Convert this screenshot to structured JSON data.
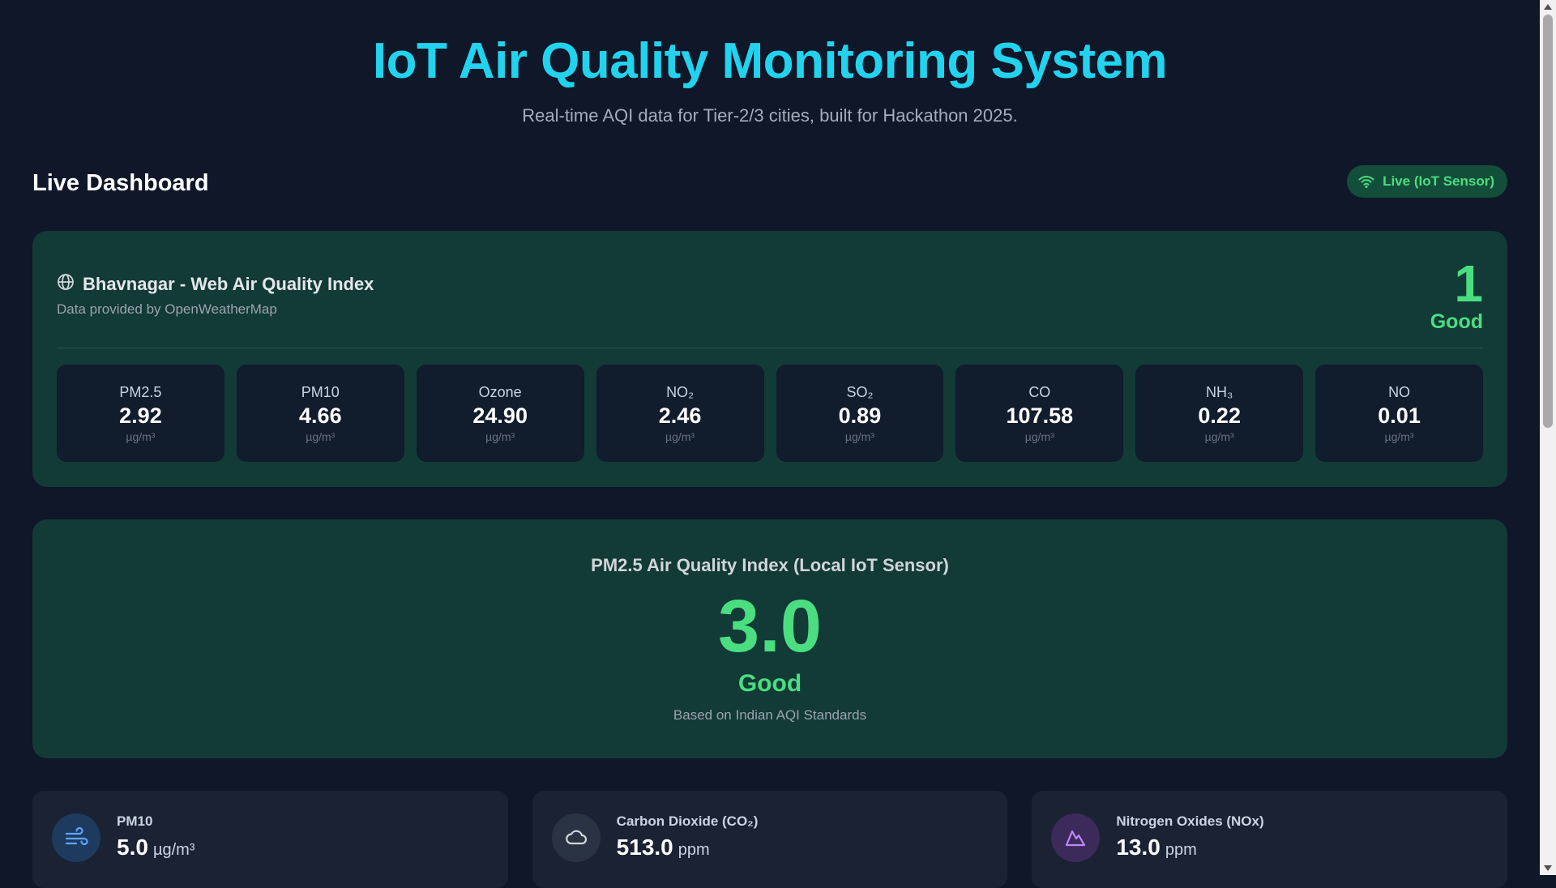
{
  "header": {
    "title": "IoT Air Quality Monitoring System",
    "subtitle": "Real-time AQI data for Tier-2/3 cities, built for Hackathon 2025."
  },
  "dashboard": {
    "title": "Live Dashboard",
    "status": {
      "label": "Live (IoT Sensor)",
      "icon": "wifi-icon",
      "color": "#4ade80"
    }
  },
  "web_aqi": {
    "icon": "globe-icon",
    "title": "Bhavnagar - Web Air Quality Index",
    "source": "Data provided by OpenWeatherMap",
    "aqi_value": "1",
    "aqi_label": "Good",
    "pollutants": [
      {
        "name": "PM2.5",
        "value": "2.92",
        "unit": "µg/m³"
      },
      {
        "name": "PM10",
        "value": "4.66",
        "unit": "µg/m³"
      },
      {
        "name": "Ozone",
        "value": "24.90",
        "unit": "µg/m³"
      },
      {
        "name": "NO₂",
        "value": "2.46",
        "unit": "µg/m³"
      },
      {
        "name": "SO₂",
        "value": "0.89",
        "unit": "µg/m³"
      },
      {
        "name": "CO",
        "value": "107.58",
        "unit": "µg/m³"
      },
      {
        "name": "NH₃",
        "value": "0.22",
        "unit": "µg/m³"
      },
      {
        "name": "NO",
        "value": "0.01",
        "unit": "µg/m³"
      }
    ]
  },
  "local_aqi": {
    "title": "PM2.5 Air Quality Index (Local IoT Sensor)",
    "value": "3.0",
    "label": "Good",
    "note": "Based on Indian AQI Standards"
  },
  "metrics": [
    {
      "label": "PM10",
      "value": "5.0",
      "unit": "µg/m³",
      "icon": "wind-icon",
      "icon_color": "#60a5fa",
      "icon_bg": "#1e3a5f"
    },
    {
      "label": "Carbon Dioxide (CO₂)",
      "value": "513.0",
      "unit": "ppm",
      "icon": "cloud-icon",
      "icon_color": "#d1d5db",
      "icon_bg": "#2a3344"
    },
    {
      "label": "Nitrogen Oxides (NOx)",
      "value": "13.0",
      "unit": "ppm",
      "icon": "mountain-icon",
      "icon_color": "#c084fc",
      "icon_bg": "#3b2a5a"
    }
  ],
  "colors": {
    "accent": "#22d3ee",
    "good": "#4ade80",
    "card": "#123a36",
    "background": "#0f1729"
  }
}
